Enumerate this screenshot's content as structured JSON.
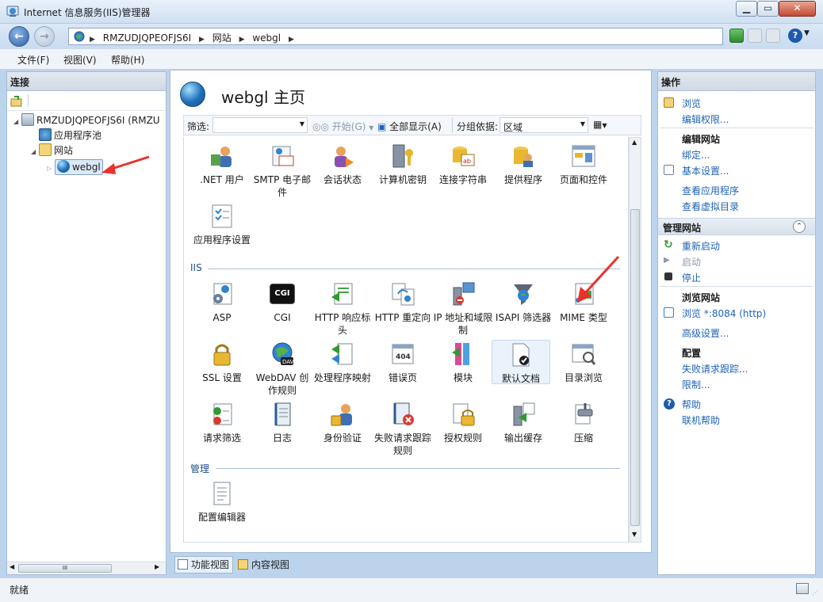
{
  "window": {
    "title": "Internet 信息服务(IIS)管理器",
    "min": "▁",
    "max": "▭",
    "close": "✕"
  },
  "address": {
    "crumbs": [
      "RMZUDJQPEOFJS6I",
      "网站",
      "webgl"
    ]
  },
  "menu": {
    "items": [
      "文件(F)",
      "视图(V)",
      "帮助(H)"
    ]
  },
  "connections": {
    "title": "连接",
    "tree": [
      {
        "label": "RMZUDJQPEOFJS6I (RMZU",
        "level": 0,
        "icon": "server-icon"
      },
      {
        "label": "应用程序池",
        "level": 1,
        "icon": "app-pool-icon"
      },
      {
        "label": "网站",
        "level": 1,
        "icon": "sites-folder-icon"
      },
      {
        "label": "webgl",
        "level": 2,
        "icon": "globe-icon",
        "selected": true
      }
    ],
    "scroll_mark": "III"
  },
  "center": {
    "title": "webgl 主页",
    "filter": {
      "label": "筛选:",
      "go": "开始(G)",
      "showall": "全部显示(A)",
      "groupby_label": "分组依据:",
      "groupby_value": "区域"
    },
    "aspnet_features": [
      {
        "label": ".NET 用户",
        "icon": "dotnet-users-icon"
      },
      {
        "label": "SMTP 电子邮件",
        "icon": "smtp-email-icon"
      },
      {
        "label": "会话状态",
        "icon": "session-state-icon"
      },
      {
        "label": "计算机密钥",
        "icon": "machine-key-icon"
      },
      {
        "label": "连接字符串",
        "icon": "connection-strings-icon"
      },
      {
        "label": "提供程序",
        "icon": "providers-icon"
      },
      {
        "label": "页面和控件",
        "icon": "pages-controls-icon"
      },
      {
        "label": "应用程序设置",
        "icon": "app-settings-icon"
      }
    ],
    "iis_group": "IIS",
    "iis_features": [
      {
        "label": "ASP",
        "icon": "asp-icon"
      },
      {
        "label": "CGI",
        "icon": "cgi-icon"
      },
      {
        "label": "HTTP 响应标头",
        "icon": "http-headers-icon"
      },
      {
        "label": "HTTP 重定向",
        "icon": "http-redirect-icon"
      },
      {
        "label": "IP 地址和域限制",
        "icon": "ip-restrictions-icon"
      },
      {
        "label": "ISAPI 筛选器",
        "icon": "isapi-filters-icon"
      },
      {
        "label": "MIME 类型",
        "icon": "mime-types-icon"
      },
      {
        "label": "SSL 设置",
        "icon": "ssl-lock-icon"
      },
      {
        "label": "WebDAV 创作规则",
        "icon": "webdav-icon"
      },
      {
        "label": "处理程序映射",
        "icon": "handler-mappings-icon"
      },
      {
        "label": "错误页",
        "icon": "error-pages-icon"
      },
      {
        "label": "模块",
        "icon": "modules-icon"
      },
      {
        "label": "默认文档",
        "icon": "default-document-icon",
        "selected": true
      },
      {
        "label": "目录浏览",
        "icon": "directory-browsing-icon"
      },
      {
        "label": "请求筛选",
        "icon": "request-filtering-icon"
      },
      {
        "label": "日志",
        "icon": "logging-icon"
      },
      {
        "label": "身份验证",
        "icon": "authentication-icon"
      },
      {
        "label": "失败请求跟踪规则",
        "icon": "failed-request-tracing-icon"
      },
      {
        "label": "授权规则",
        "icon": "authorization-rules-icon"
      },
      {
        "label": "输出缓存",
        "icon": "output-caching-icon"
      },
      {
        "label": "压缩",
        "icon": "compression-icon"
      }
    ],
    "mgmt_group": "管理",
    "mgmt_features": [
      {
        "label": "配置编辑器",
        "icon": "config-editor-icon"
      }
    ],
    "cgi_badge": "CGI",
    "error_badge": "404",
    "webdav_badge": "DAV",
    "tabs": {
      "features": "功能视图",
      "content": "内容视图"
    }
  },
  "actions": {
    "title": "操作",
    "browse": "浏览",
    "edit_perms": "编辑权限...",
    "edit_site": "编辑网站",
    "bindings": "绑定...",
    "basic_settings": "基本设置...",
    "view_apps": "查看应用程序",
    "view_vdirs": "查看虚拟目录",
    "manage_site": "管理网站",
    "restart": "重新启动",
    "start": "启动",
    "stop": "停止",
    "browse_site": "浏览网站",
    "browse_port": "浏览 *:8084 (http)",
    "advanced": "高级设置...",
    "config": "配置",
    "failed_tracing": "失败请求跟踪...",
    "limits": "限制...",
    "help": "帮助",
    "online_help": "联机帮助"
  },
  "status": {
    "text": "就绪"
  },
  "colors": {
    "accent": "#1e63b4",
    "arrow": "#e8322d"
  }
}
